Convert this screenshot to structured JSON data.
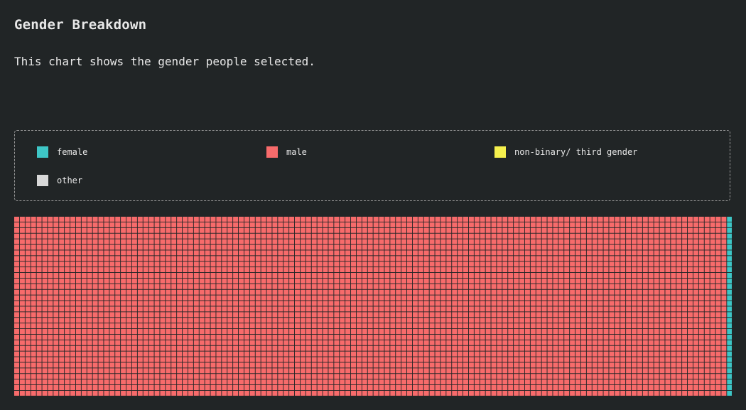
{
  "page": {
    "title": "Gender Breakdown",
    "description": "This chart shows the gender people selected."
  },
  "chart_data": {
    "type": "waffle",
    "legend_placement": "top",
    "grid": true,
    "categories": [
      {
        "name": "female",
        "color": "#3ec6c6",
        "value": 210
      },
      {
        "name": "male",
        "color": "#f76b6b",
        "value": 4064
      },
      {
        "name": "non-binary/ third gender",
        "color": "#f5f04d",
        "value": 36
      },
      {
        "name": "other",
        "color": "#d8d8d8",
        "value": 14
      }
    ],
    "order": [
      "male",
      "female",
      "non-binary/ third gender",
      "other"
    ]
  },
  "colors": {
    "background": "#212526",
    "cell_border": "#212526"
  }
}
